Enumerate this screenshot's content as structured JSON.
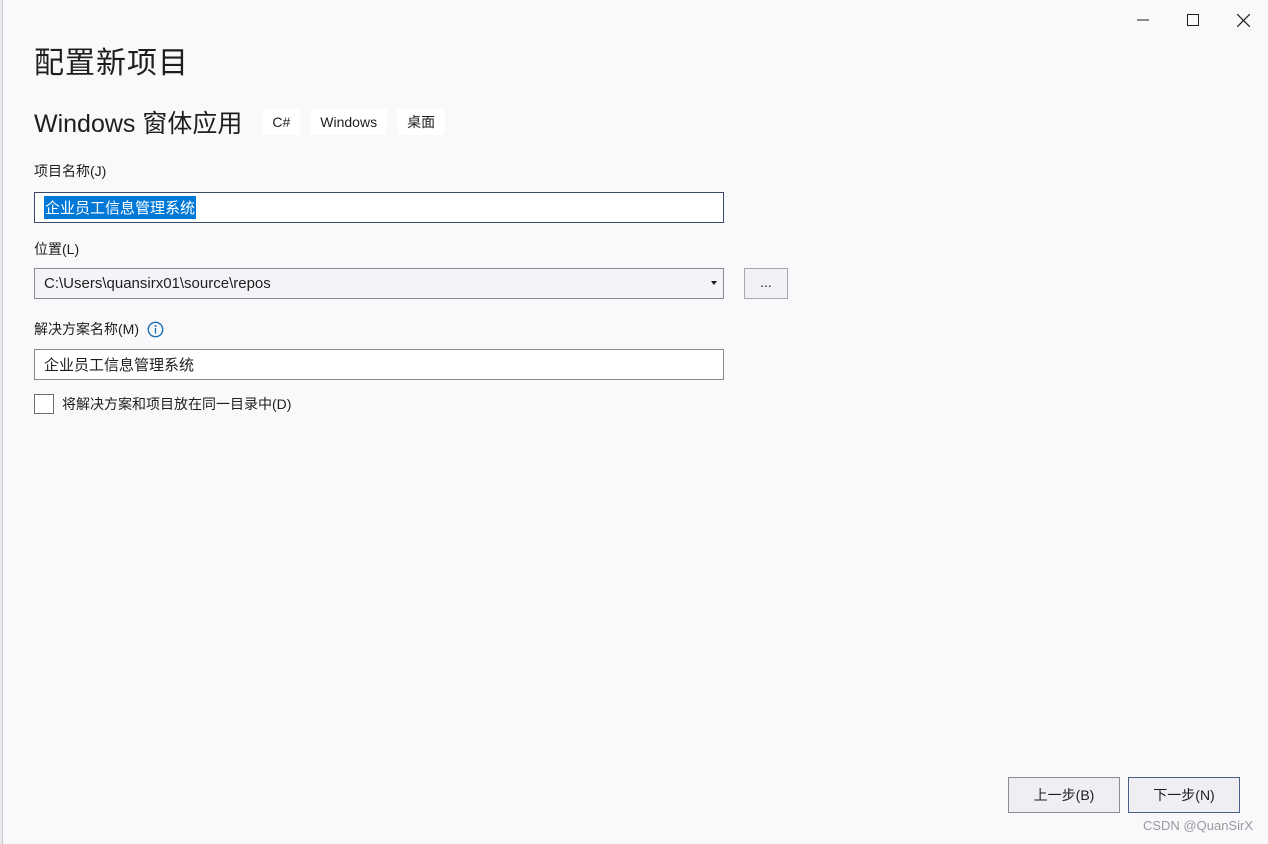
{
  "window": {
    "title": "配置新项目",
    "controls": [
      "minimize-icon",
      "maximize-icon",
      "close-icon"
    ]
  },
  "template": {
    "name": "Windows 窗体应用",
    "tags": [
      "C#",
      "Windows",
      "桌面"
    ]
  },
  "project_name": {
    "label": "项目名称(J)",
    "value": "企业员工信息管理系统"
  },
  "location": {
    "label": "位置(L)",
    "value": "C:\\Users\\quansirx01\\source\\repos",
    "browse_label": "..."
  },
  "solution_name": {
    "label": "解决方案名称(M)",
    "value": "企业员工信息管理系统"
  },
  "same_dir": {
    "label": "将解决方案和项目放在同一目录中(D)",
    "checked": false
  },
  "footer": {
    "back_label": "上一步(B)",
    "next_label": "下一步(N)"
  },
  "watermark": "CSDN @QuanSirX",
  "colors": {
    "background": "#f9f9fb",
    "selection": "#0078d7",
    "info_icon": "#1a6fb5"
  }
}
